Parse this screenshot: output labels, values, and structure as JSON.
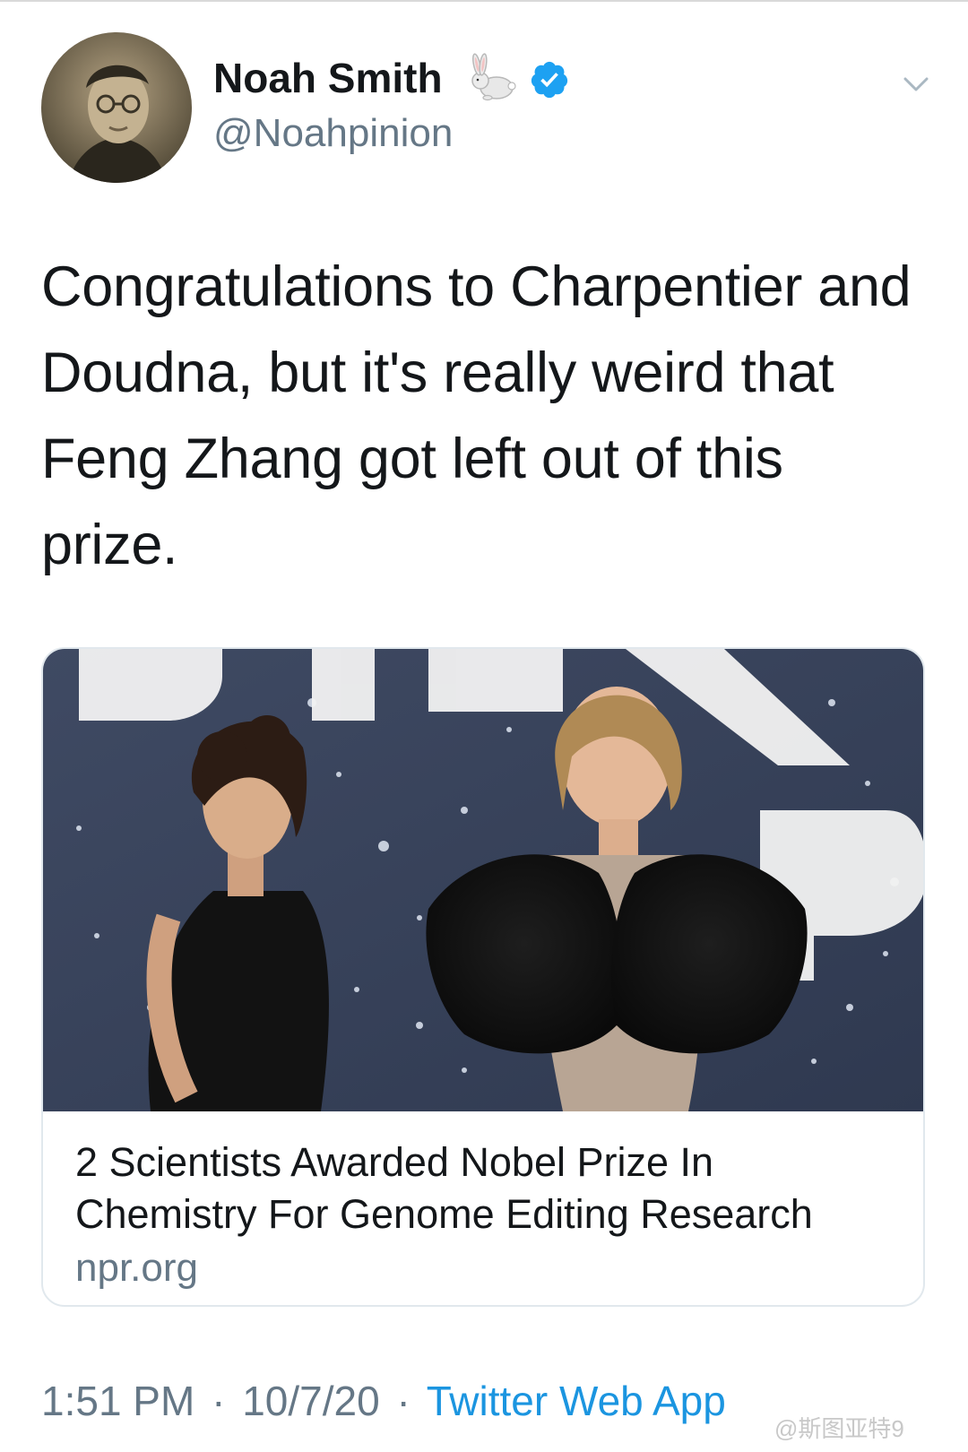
{
  "header": {
    "author_name": "Noah Smith",
    "author_handle": "@Noahpinion",
    "name_emoji_icon": "rabbit-icon",
    "verified_icon": "verified-badge-icon",
    "menu_icon": "chevron-down-icon"
  },
  "tweet": {
    "text": "Congratulations to Charpentier and Doudna, but it's really weird that Feng Zhang got left out of this prize."
  },
  "card": {
    "title": "2 Scientists Awarded Nobel Prize In Chemistry For Genome Editing Research",
    "domain": "npr.org",
    "image_backdrop_text": "BREAK PR"
  },
  "meta": {
    "time": "1:51 PM",
    "date": "10/7/20",
    "source": "Twitter Web App",
    "separator": "·"
  },
  "watermark": {
    "text": "@斯图亚特9"
  },
  "colors": {
    "text_primary": "#14171a",
    "text_secondary": "#657786",
    "link_blue": "#1b95e0",
    "verified_blue": "#1da1f2",
    "card_border": "#e1e8ed"
  }
}
